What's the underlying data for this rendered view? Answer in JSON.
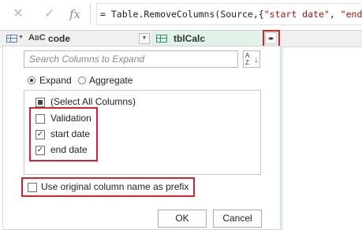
{
  "formula_bar": {
    "cancel_icon": "✕",
    "confirm_icon": "✓",
    "fx_label": "fx",
    "formula_prefix": "= Table.RemoveColumns(Source,{",
    "formula_string1": "\"start date\"",
    "formula_sep": ", ",
    "formula_string2": "\"end da"
  },
  "header": {
    "abc_label": "A",
    "abc_sub": "B",
    "abc_c": "C",
    "code_col": "code",
    "calc_col": "tblCalc"
  },
  "expand_panel": {
    "search_placeholder": "Search Columns to Expand",
    "sort_az": "A\nZ",
    "mode_expand": "Expand",
    "mode_aggregate": "Aggregate",
    "selected_mode": "Expand",
    "items": [
      {
        "label": "(Select All Columns)",
        "state": "partial"
      },
      {
        "label": "Validation",
        "state": "unchecked"
      },
      {
        "label": "start date",
        "state": "checked"
      },
      {
        "label": "end date",
        "state": "checked"
      }
    ],
    "prefix_label": "Use original column name as prefix",
    "prefix_checked": false,
    "ok_label": "OK",
    "cancel_label": "Cancel"
  },
  "colors": {
    "highlight": "#d6232f",
    "calc_column_bg": "#e1f2e9",
    "accent_blue": "#2f6bb3"
  }
}
